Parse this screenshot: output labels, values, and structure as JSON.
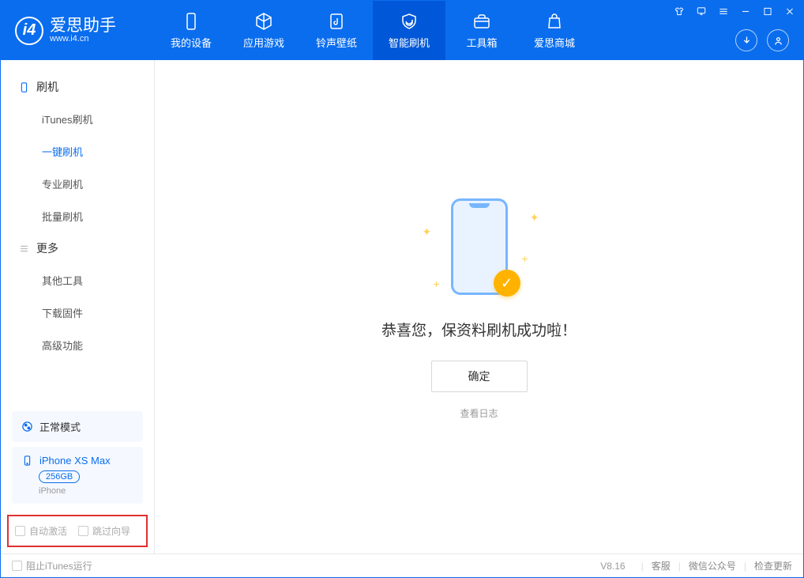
{
  "app": {
    "name": "爱思助手",
    "url": "www.i4.cn"
  },
  "nav": {
    "tabs": [
      {
        "label": "我的设备"
      },
      {
        "label": "应用游戏"
      },
      {
        "label": "铃声壁纸"
      },
      {
        "label": "智能刷机"
      },
      {
        "label": "工具箱"
      },
      {
        "label": "爱思商城"
      }
    ]
  },
  "sidebar": {
    "section1": {
      "title": "刷机",
      "items": [
        "iTunes刷机",
        "一键刷机",
        "专业刷机",
        "批量刷机"
      ]
    },
    "section2": {
      "title": "更多",
      "items": [
        "其他工具",
        "下载固件",
        "高级功能"
      ]
    },
    "mode": "正常模式",
    "device": {
      "name": "iPhone XS Max",
      "storage": "256GB",
      "type": "iPhone"
    },
    "opts": {
      "auto_activate": "自动激活",
      "skip_wizard": "跳过向导"
    }
  },
  "main": {
    "success": "恭喜您，保资料刷机成功啦！",
    "ok": "确定",
    "view_log": "查看日志"
  },
  "footer": {
    "block_itunes": "阻止iTunes运行",
    "version": "V8.16",
    "links": [
      "客服",
      "微信公众号",
      "检查更新"
    ]
  }
}
